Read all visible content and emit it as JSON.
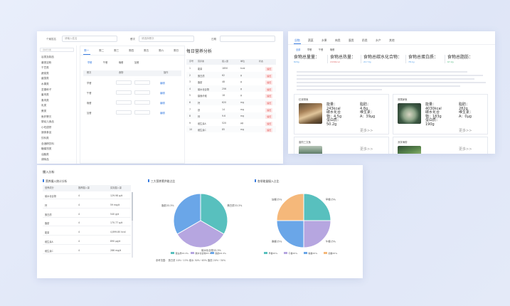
{
  "meal_panel": {
    "search_fields": [
      {
        "label": "个案姓名",
        "value": "请输入姓名"
      },
      {
        "label": "餐次",
        "value": "请选择餐次"
      },
      {
        "label": "日期",
        "value": ""
      }
    ],
    "sidebar_header": "食材分类",
    "sidebar_items": [
      "谷类及制品",
      "薯类淀粉",
      "干豆类",
      "蔬菜类",
      "菌藻类",
      "水果类",
      "坚果种子",
      "畜肉类",
      "禽肉类",
      "乳类",
      "蛋类",
      "鱼虾蟹贝",
      "婴幼儿食品",
      "小吃甜饼",
      "速食食品",
      "饮料类",
      "含酒精饮料",
      "糖蜜饯类",
      "油脂类",
      "调味品"
    ],
    "day_tabs": [
      "周一",
      "周二",
      "周三",
      "周四",
      "周五",
      "周六",
      "周日"
    ],
    "meal_tabs": [
      "早餐",
      "午餐",
      "晚餐",
      "加餐"
    ],
    "table_headers": [
      "餐次",
      "食物",
      "操作"
    ],
    "meal_rows": [
      "早餐",
      "午餐",
      "晚餐",
      "加餐"
    ],
    "edit_label": "编辑",
    "nutrition_title": "每日营养分析",
    "nutrition_headers": [
      "序号",
      "营养素",
      "摄入量",
      "单位",
      "状态"
    ],
    "nutrition_rows": [
      {
        "no": "1",
        "name": "能量",
        "value": "1850",
        "unit": "kcal",
        "status": "偏低"
      },
      {
        "no": "2",
        "name": "蛋白质",
        "value": "62",
        "unit": "g",
        "status": "偏低"
      },
      {
        "no": "3",
        "name": "脂肪",
        "value": "48",
        "unit": "g",
        "status": "偏低"
      },
      {
        "no": "4",
        "name": "碳水化合物",
        "value": "256",
        "unit": "g",
        "status": "偏低"
      },
      {
        "no": "5",
        "name": "膳食纤维",
        "value": "18",
        "unit": "g",
        "status": "偏低"
      },
      {
        "no": "6",
        "name": "钙",
        "value": "620",
        "unit": "mg",
        "status": "偏低"
      },
      {
        "no": "7",
        "name": "铁",
        "value": "14",
        "unit": "mg",
        "status": "偏低"
      },
      {
        "no": "8",
        "name": "锌",
        "value": "9.6",
        "unit": "mg",
        "status": "偏低"
      },
      {
        "no": "9",
        "name": "维生素A",
        "value": "520",
        "unit": "μg",
        "status": "偏低"
      },
      {
        "no": "10",
        "name": "维生素C",
        "value": "85",
        "unit": "mg",
        "status": "偏低"
      }
    ]
  },
  "food_panel": {
    "tabs": [
      "谷物",
      "蔬菜",
      "水果",
      "肉类",
      "蛋类",
      "奶类",
      "水产",
      "其他"
    ],
    "sub_tabs": [
      "全部",
      "早餐",
      "午餐",
      "晚餐"
    ],
    "stats": [
      {
        "label": "食物总量量：",
        "sub": "820g",
        "sub_color": "#4c9be8"
      },
      {
        "label": "食物总热量：",
        "sub": "2430kcal",
        "sub_color": "#e06a6a"
      },
      {
        "label": "食物总碳水化合物：",
        "sub": "217.3g",
        "sub_color": "#4c9be8"
      },
      {
        "label": "食物总蛋白质：",
        "sub": "78.1g",
        "sub_color": "#4c9be8"
      },
      {
        "label": "食物总脂肪：",
        "sub": "67.2g",
        "sub_color": "#4cb87a"
      }
    ],
    "cards": [
      {
        "title": "红烧带鱼",
        "lines_left": [
          "能量：",
          "243kcal",
          "碳水化合",
          "物：4.5g",
          "蛋白质：",
          "50.2g"
        ],
        "lines_right": [
          "脂肪：",
          "4.8g",
          "维生素：",
          "A：39μg"
        ],
        "more": "更多>>"
      },
      {
        "title": "清蒸鲈鱼",
        "lines_left": [
          "能量：",
          "4030kcal",
          "碳水化合",
          "物：183g",
          "蛋白质：",
          "190g"
        ],
        "lines_right": [
          "脂肪：",
          "282g",
          "维生素：",
          "A：0μg"
        ],
        "more": "更多>>"
      },
      {
        "title": "香煎三文鱼",
        "more": "更多>>"
      },
      {
        "title": "凉拌海带",
        "more": "更多>>"
      }
    ]
  },
  "analysis_panel": {
    "title": "摄入分析",
    "table_title": "营养摄入统计分析",
    "headers": [
      "营养成分",
      "推荐摄入量",
      "实际摄入量"
    ],
    "rows": [
      {
        "name": "碳水化合物",
        "rec": "4",
        "actual": "129.98 g/d"
      },
      {
        "name": "钙",
        "rec": "4",
        "actual": "59 mg/d"
      },
      {
        "name": "蛋白质",
        "rec": "4",
        "actual": "540 g/d"
      },
      {
        "name": "脂肪",
        "rec": "4",
        "actual": "170.77 g/d"
      },
      {
        "name": "能量",
        "rec": "4",
        "actual": "4,899.80 kcal"
      },
      {
        "name": "维生素A",
        "rec": "4",
        "actual": "890 μg/d"
      },
      {
        "name": "维生素C",
        "rec": "4",
        "actual": "286 mg/d"
      }
    ],
    "charts": [
      {
        "title": "三大营养素供能占比",
        "slices": [
          {
            "name": "蛋白质",
            "value": 33.3,
            "color": "#58c0be",
            "label": "蛋白质33.3%"
          },
          {
            "name": "碳水化合物",
            "value": 33.3,
            "color": "#b6a6e0",
            "label": "碳水化合物33.3%"
          },
          {
            "name": "脂肪",
            "value": 33.3,
            "color": "#6aa6e8",
            "label": "脂肪33.3%"
          }
        ],
        "legend": [
          "蛋白质33.3%",
          "碳水化合物33.3%",
          "脂肪33.3%"
        ],
        "footnote": "参考范围：  蛋白质 10%~15%    碳水 50%~65%    脂肪 20%~30%"
      },
      {
        "title": "各餐能量摄入占比",
        "slices": [
          {
            "name": "早餐",
            "value": 25,
            "color": "#58c0be",
            "label": "早餐25%"
          },
          {
            "name": "午餐",
            "value": 25,
            "color": "#b6a6e0",
            "label": "午餐25%"
          },
          {
            "name": "晚餐",
            "value": 25,
            "color": "#6aa6e8",
            "label": "晚餐25%"
          },
          {
            "name": "加餐",
            "value": 25,
            "color": "#f5b87a",
            "label": "加餐25%"
          }
        ],
        "legend": [
          "早餐25%",
          "午餐25%",
          "晚餐25%",
          "加餐25%"
        ]
      }
    ]
  },
  "colors": {
    "accent": "#3a7de0",
    "teal": "#58c0be",
    "lavender": "#b6a6e0",
    "blue": "#6aa6e8",
    "orange": "#f5b87a"
  }
}
